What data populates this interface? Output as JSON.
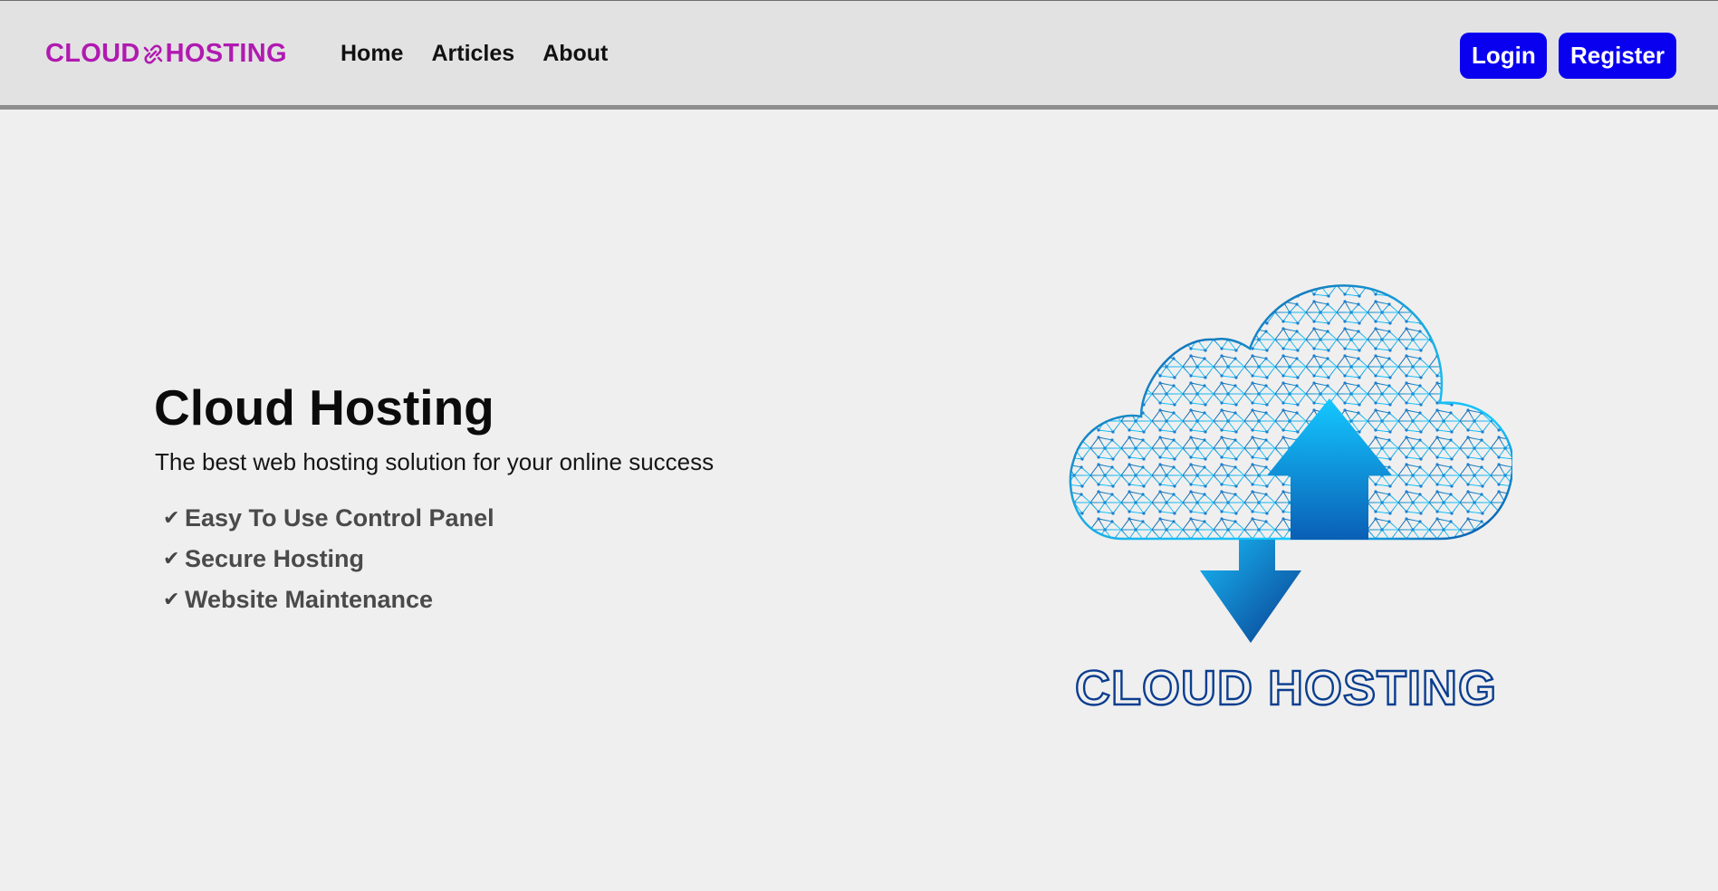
{
  "brand": {
    "name_left": "CLOUD",
    "name_right": "HOSTING",
    "color": "#b01ab0",
    "icon": "link-icon"
  },
  "nav": {
    "links": [
      {
        "label": "Home"
      },
      {
        "label": "Articles"
      },
      {
        "label": "About"
      }
    ]
  },
  "auth": {
    "login_label": "Login",
    "register_label": "Register",
    "button_color": "#0a00f0"
  },
  "hero": {
    "title": "Cloud Hosting",
    "subtitle": "The best web hosting solution for your online success",
    "features": [
      {
        "icon": "check-icon",
        "label": "Easy To Use Control Panel"
      },
      {
        "icon": "check-icon",
        "label": "Secure Hosting"
      },
      {
        "icon": "check-icon",
        "label": "Website Maintenance"
      }
    ]
  },
  "illustration": {
    "icon": "cloud-upload-download-icon",
    "caption": "CLOUD HOSTING",
    "colors": {
      "light": "#16c7ff",
      "dark": "#0a3d8f"
    }
  }
}
